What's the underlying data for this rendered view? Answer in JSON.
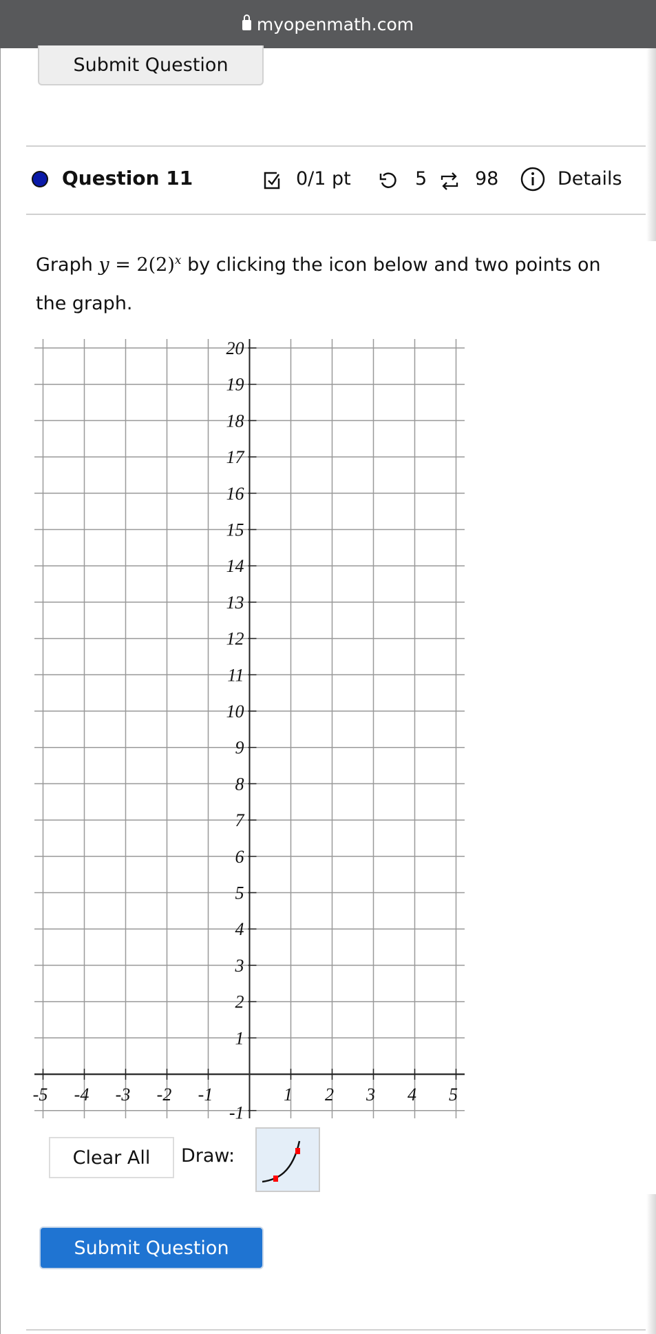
{
  "browser": {
    "url": "myopenmath.com"
  },
  "top_submit": {
    "label": "Submit Question"
  },
  "question": {
    "title": "Question 11",
    "score": "0/1 pt",
    "retries": "5",
    "attempts": "98",
    "details_label": "Details",
    "dot_color": "#0a1aa8"
  },
  "prompt": {
    "before": "Graph ",
    "math_lhs": "y",
    "math_eq": " = 2(2)",
    "math_exp": "x",
    "after": " by clicking the icon below and two points on the graph."
  },
  "graph": {
    "x_range": [
      -5,
      5
    ],
    "y_range": [
      -1,
      20
    ],
    "x_tick_labels": [
      "-5",
      "-4",
      "-3",
      "-2",
      "-1",
      "1",
      "2",
      "3",
      "4",
      "5"
    ],
    "y_tick_labels": [
      "-1",
      "1",
      "2",
      "3",
      "4",
      "5",
      "6",
      "7",
      "8",
      "9",
      "10",
      "11",
      "12",
      "13",
      "14",
      "15",
      "16",
      "17",
      "18",
      "19",
      "20"
    ],
    "grid": true
  },
  "controls": {
    "clear_all": "Clear All",
    "draw_label": "Draw:",
    "draw_tool": "exponential-curve-icon"
  },
  "bottom_submit": {
    "label": "Submit Question",
    "color": "#1f74d2"
  }
}
